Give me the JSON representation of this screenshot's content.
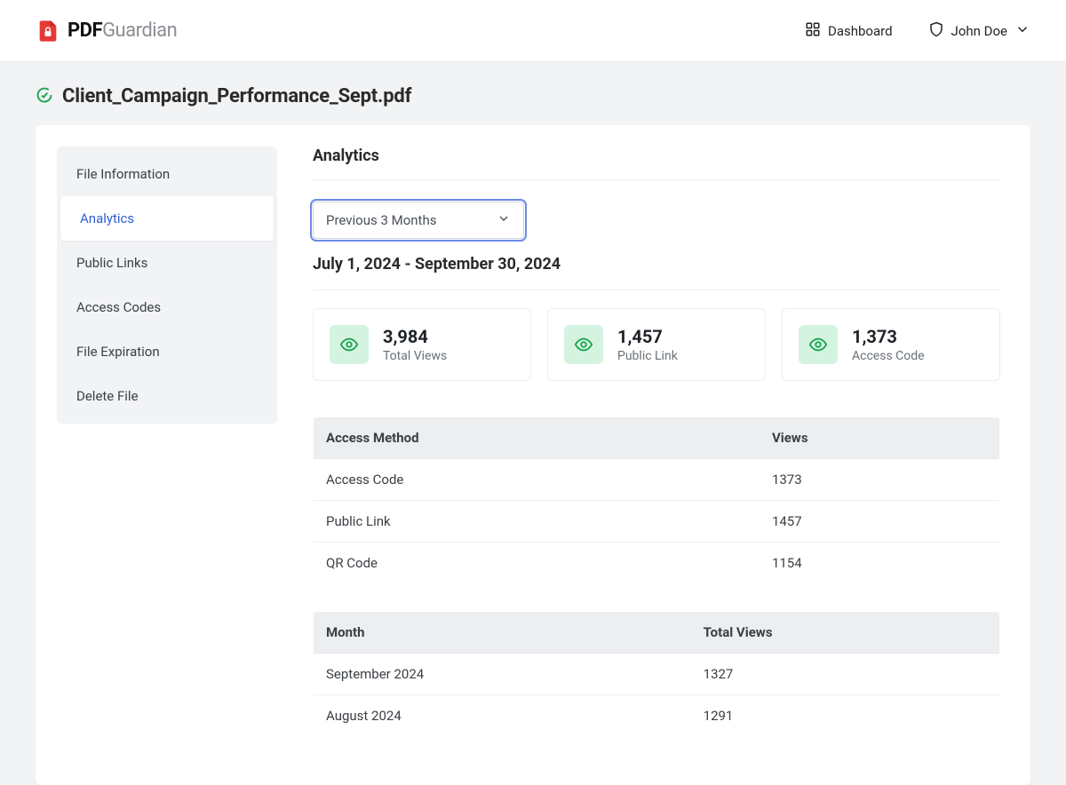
{
  "brand": {
    "bold": "PDF",
    "light": "Guardian"
  },
  "header": {
    "dashboard": "Dashboard",
    "user_name": "John Doe"
  },
  "file": {
    "name": "Client_Campaign_Performance_Sept.pdf"
  },
  "sidebar": {
    "items": [
      {
        "label": "File Information"
      },
      {
        "label": "Analytics"
      },
      {
        "label": "Public Links"
      },
      {
        "label": "Access Codes"
      },
      {
        "label": "File Expiration"
      },
      {
        "label": "Delete File"
      }
    ],
    "active_index": 1
  },
  "analytics": {
    "title": "Analytics",
    "range_select": "Previous 3 Months",
    "range_display": "July 1, 2024 - September 30, 2024",
    "stats": [
      {
        "value": "3,984",
        "label": "Total Views"
      },
      {
        "value": "1,457",
        "label": "Public Link"
      },
      {
        "value": "1,373",
        "label": "Access Code"
      }
    ],
    "access_table": {
      "headers": [
        "Access Method",
        "Views"
      ],
      "rows": [
        {
          "method": "Access Code",
          "views": "1373"
        },
        {
          "method": "Public Link",
          "views": "1457"
        },
        {
          "method": "QR Code",
          "views": "1154"
        }
      ]
    },
    "month_table": {
      "headers": [
        "Month",
        "Total Views"
      ],
      "rows": [
        {
          "month": "September 2024",
          "views": "1327"
        },
        {
          "month": "August 2024",
          "views": "1291"
        }
      ]
    }
  }
}
